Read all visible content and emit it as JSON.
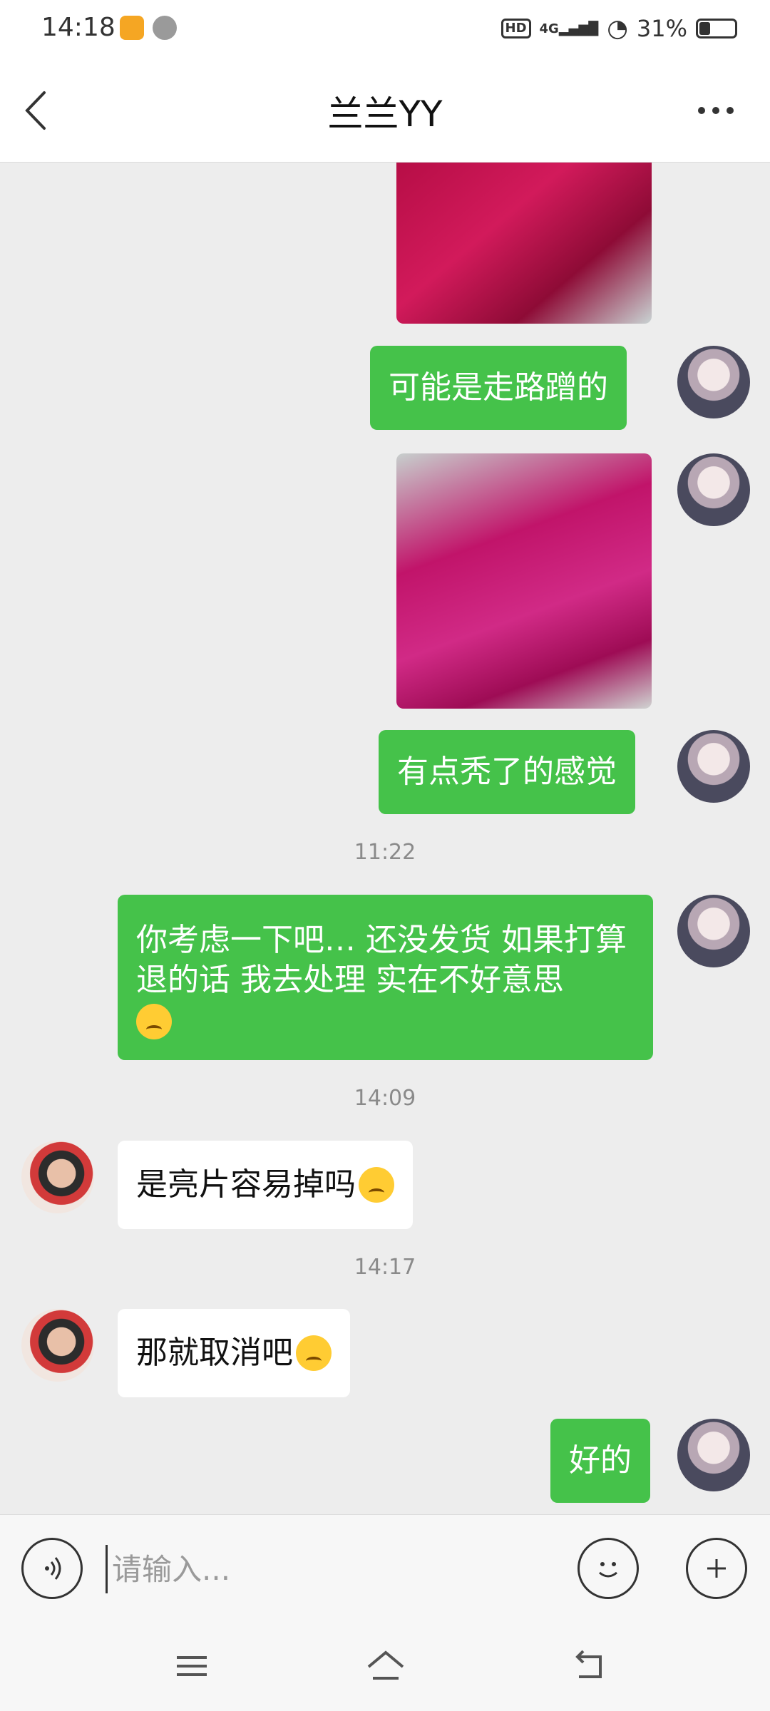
{
  "status_bar": {
    "time": "14:18",
    "hd": "HD",
    "network": "4G",
    "battery_text": "31%",
    "battery_level": 0.31
  },
  "header": {
    "title": "兰兰YY"
  },
  "messages": [
    {
      "type": "image",
      "side": "right",
      "description_icon": "image"
    },
    {
      "type": "text",
      "side": "right",
      "text": "可能是走路蹭的"
    },
    {
      "type": "image",
      "side": "right",
      "description_icon": "image"
    },
    {
      "type": "text",
      "side": "right",
      "text": "有点秃了的感觉"
    },
    {
      "type": "timestamp",
      "text": "11:22"
    },
    {
      "type": "text",
      "side": "right",
      "text": "你考虑一下吧… 还没发货 如果打算退的话 我去处理 实在不好意思"
    },
    {
      "type": "timestamp",
      "text": "14:09"
    },
    {
      "type": "text",
      "side": "left",
      "text": "是亮片容易掉吗"
    },
    {
      "type": "timestamp",
      "text": "14:17"
    },
    {
      "type": "text",
      "side": "left",
      "text": "那就取消吧"
    },
    {
      "type": "text",
      "side": "right",
      "text": "好的"
    }
  ],
  "input": {
    "placeholder": "请输入..."
  },
  "colors": {
    "bubble_right": "#45c24a",
    "background": "#ededed"
  }
}
